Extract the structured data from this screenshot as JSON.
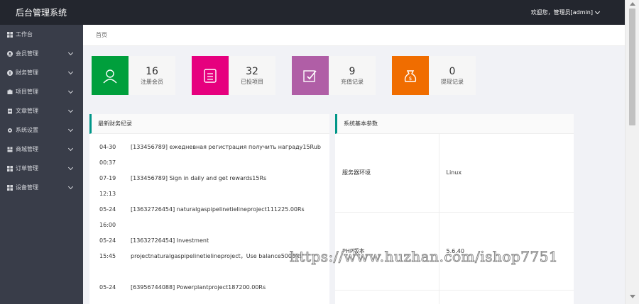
{
  "header": {
    "brand": "后台管理系统",
    "user_label": "欢迎您，管理员[admin]"
  },
  "sidebar": {
    "items": [
      {
        "label": "工作台",
        "icon": "dashboard-icon",
        "has_arrow": false
      },
      {
        "label": "会员管理",
        "icon": "user-icon",
        "has_arrow": true
      },
      {
        "label": "财务管理",
        "icon": "finance-icon",
        "has_arrow": true
      },
      {
        "label": "项目管理",
        "icon": "project-icon",
        "has_arrow": true
      },
      {
        "label": "文章管理",
        "icon": "article-icon",
        "has_arrow": true
      },
      {
        "label": "系统设置",
        "icon": "gear-icon",
        "has_arrow": true
      },
      {
        "label": "商城管理",
        "icon": "shop-icon",
        "has_arrow": true
      },
      {
        "label": "订单管理",
        "icon": "order-icon",
        "has_arrow": true
      },
      {
        "label": "设备管理",
        "icon": "device-icon",
        "has_arrow": true
      }
    ]
  },
  "breadcrumb": "首页",
  "stats": [
    {
      "value": "16",
      "label": "注册会员",
      "color": "#009f3c",
      "icon": "user-icon"
    },
    {
      "value": "32",
      "label": "已投项目",
      "color": "#e6007e",
      "icon": "document-icon"
    },
    {
      "value": "9",
      "label": "充值记录",
      "color": "#b05ea6",
      "icon": "edit-icon"
    },
    {
      "value": "0",
      "label": "提现记录",
      "color": "#f06d00",
      "icon": "money-bag-icon"
    }
  ],
  "finance_panel": {
    "title": "最新财务纪录",
    "records": [
      {
        "time": "04-30 00:37",
        "desc": "[133456789] ежедневная регистрация получить награду15Rub"
      },
      {
        "time": "07-19 12:13",
        "desc": "[133456789] Sign in daily and get rewards15Rs"
      },
      {
        "time": "05-24 16:00",
        "desc": "[13632726454] naturalgaspipelinetielineproject111225.00Rs"
      },
      {
        "time": "05-24 15:45",
        "desc": "[13632726454] Investment projectnaturalgaspipelinetielineproject，Use balance5000Rs"
      },
      {
        "time": "05-24",
        "desc": "[63956744088] Powerplantproject187200.00Rs"
      }
    ]
  },
  "system_panel": {
    "title": "系统基本参数",
    "rows": [
      {
        "key": "服务器环境",
        "value": "Linux"
      },
      {
        "key": "PHP版本",
        "value": "5.6.40"
      }
    ]
  },
  "watermark": "https://www.huzhan.com/ishop7751"
}
